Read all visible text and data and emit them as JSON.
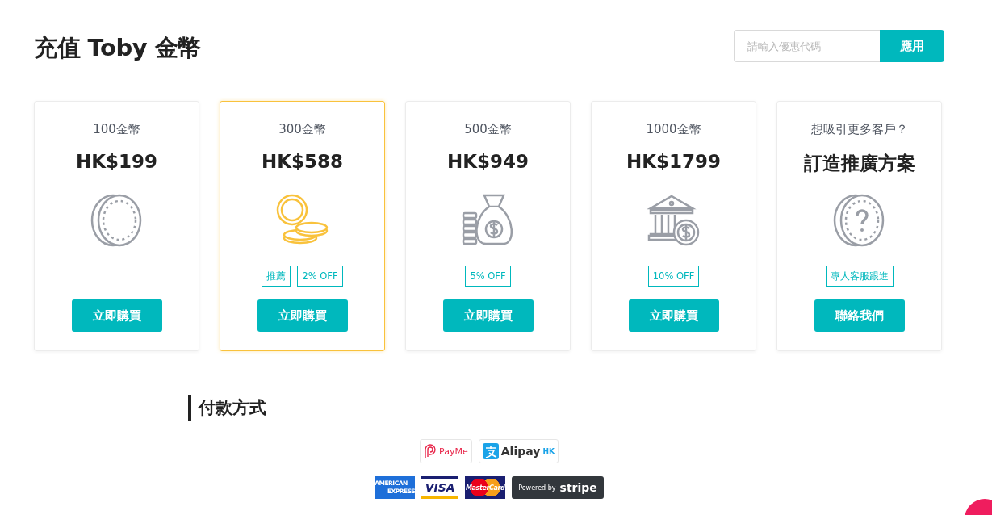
{
  "page_title": "充值 Toby 金幣",
  "promo": {
    "placeholder": "請輸入優惠代碼",
    "button": "應用"
  },
  "packages": [
    {
      "kind": "coin",
      "title": "100金幣",
      "price": "HK$199",
      "selected": false,
      "button": "立即購買"
    },
    {
      "kind": "coins",
      "title": "300金幣",
      "price": "HK$588",
      "selected": true,
      "tags": [
        "推薦",
        "2% OFF"
      ],
      "button": "立即購買"
    },
    {
      "kind": "moneybag",
      "title": "500金幣",
      "price": "HK$949",
      "selected": false,
      "tags": [
        "5% OFF"
      ],
      "button": "立即購買"
    },
    {
      "kind": "bank",
      "title": "1000金幣",
      "price": "HK$1799",
      "selected": false,
      "tags": [
        "10% OFF"
      ],
      "button": "立即購買"
    },
    {
      "kind": "question",
      "title": "想吸引更多客戶？",
      "price": "訂造推廣方案",
      "selected": false,
      "tags": [
        "專人客服跟進"
      ],
      "button": "聯絡我們"
    }
  ],
  "payment": {
    "title": "付款方式",
    "wallets": [
      {
        "kind": "payme",
        "label": "PayMe"
      },
      {
        "kind": "alipay",
        "label": "Alipay",
        "suffix": "HK"
      }
    ],
    "cards": [
      {
        "kind": "amex",
        "lines": [
          "AMERICAN",
          "EXPRESS"
        ]
      },
      {
        "kind": "visa",
        "label": "VISA"
      },
      {
        "kind": "mastercard",
        "label": "MasterCard"
      },
      {
        "kind": "stripe",
        "prefix": "Powered by",
        "label": "stripe"
      }
    ]
  }
}
